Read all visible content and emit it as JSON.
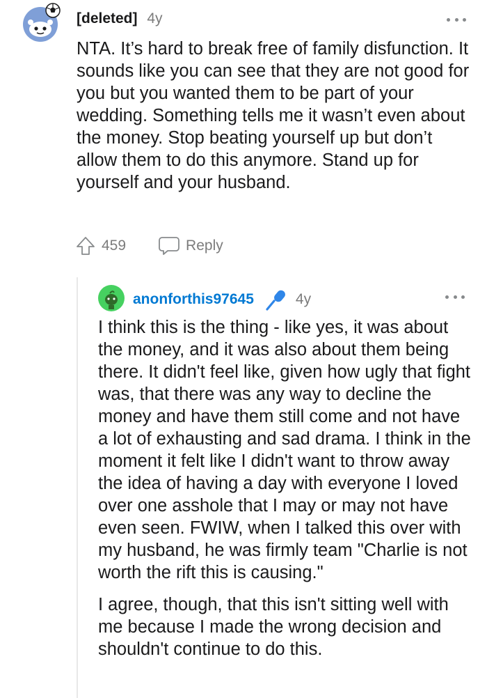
{
  "comment": {
    "author": "[deleted]",
    "age": "4y",
    "body": "NTA. It’s hard to break free of family disfunction. It sounds like you can see that they are not good for you but you wanted them to be part of your wedding. Something tells me it wasn’t even about the money. Stop beating yourself up but don’t allow them to do this anymore. Stand up for yourself and your husband.",
    "upvotes": "459",
    "reply_label": "Reply",
    "avatar_icon": "snoo-avatar-icon",
    "more_icon": "more-options-icon"
  },
  "reply": {
    "author": "anonforthis97645",
    "age": "4y",
    "paragraphs": [
      "I think this is the thing - like yes, it was about the money, and it was also about them being there. It didn't feel like, given how ugly that fight was, that there was any way to decline the money and have them still come and not have a lot of exhausting and sad drama. I think in the moment it felt like I didn't want to throw away the idea of having a day with everyone I loved over one asshole that I may or may not have even seen. FWIW, when I talked this over with my husband, he was firmly team \"Charlie is not worth the rift this is causing.\"",
      "I agree, though, that this isn't sitting well with me because I made the wrong decision and shouldn't continue to do this."
    ],
    "badge_icon": "microphone-icon",
    "avatar_icon": "green-snoo-avatar-icon",
    "more_icon": "more-options-icon"
  },
  "colors": {
    "author_link": "#0079d3",
    "meta_text": "#7c7c7c",
    "body_text": "#1a1a1b",
    "thread_line": "#e8e8e8",
    "avatar_bg_main": "#7f9fd7",
    "avatar_bg_reply": "#46d160"
  }
}
